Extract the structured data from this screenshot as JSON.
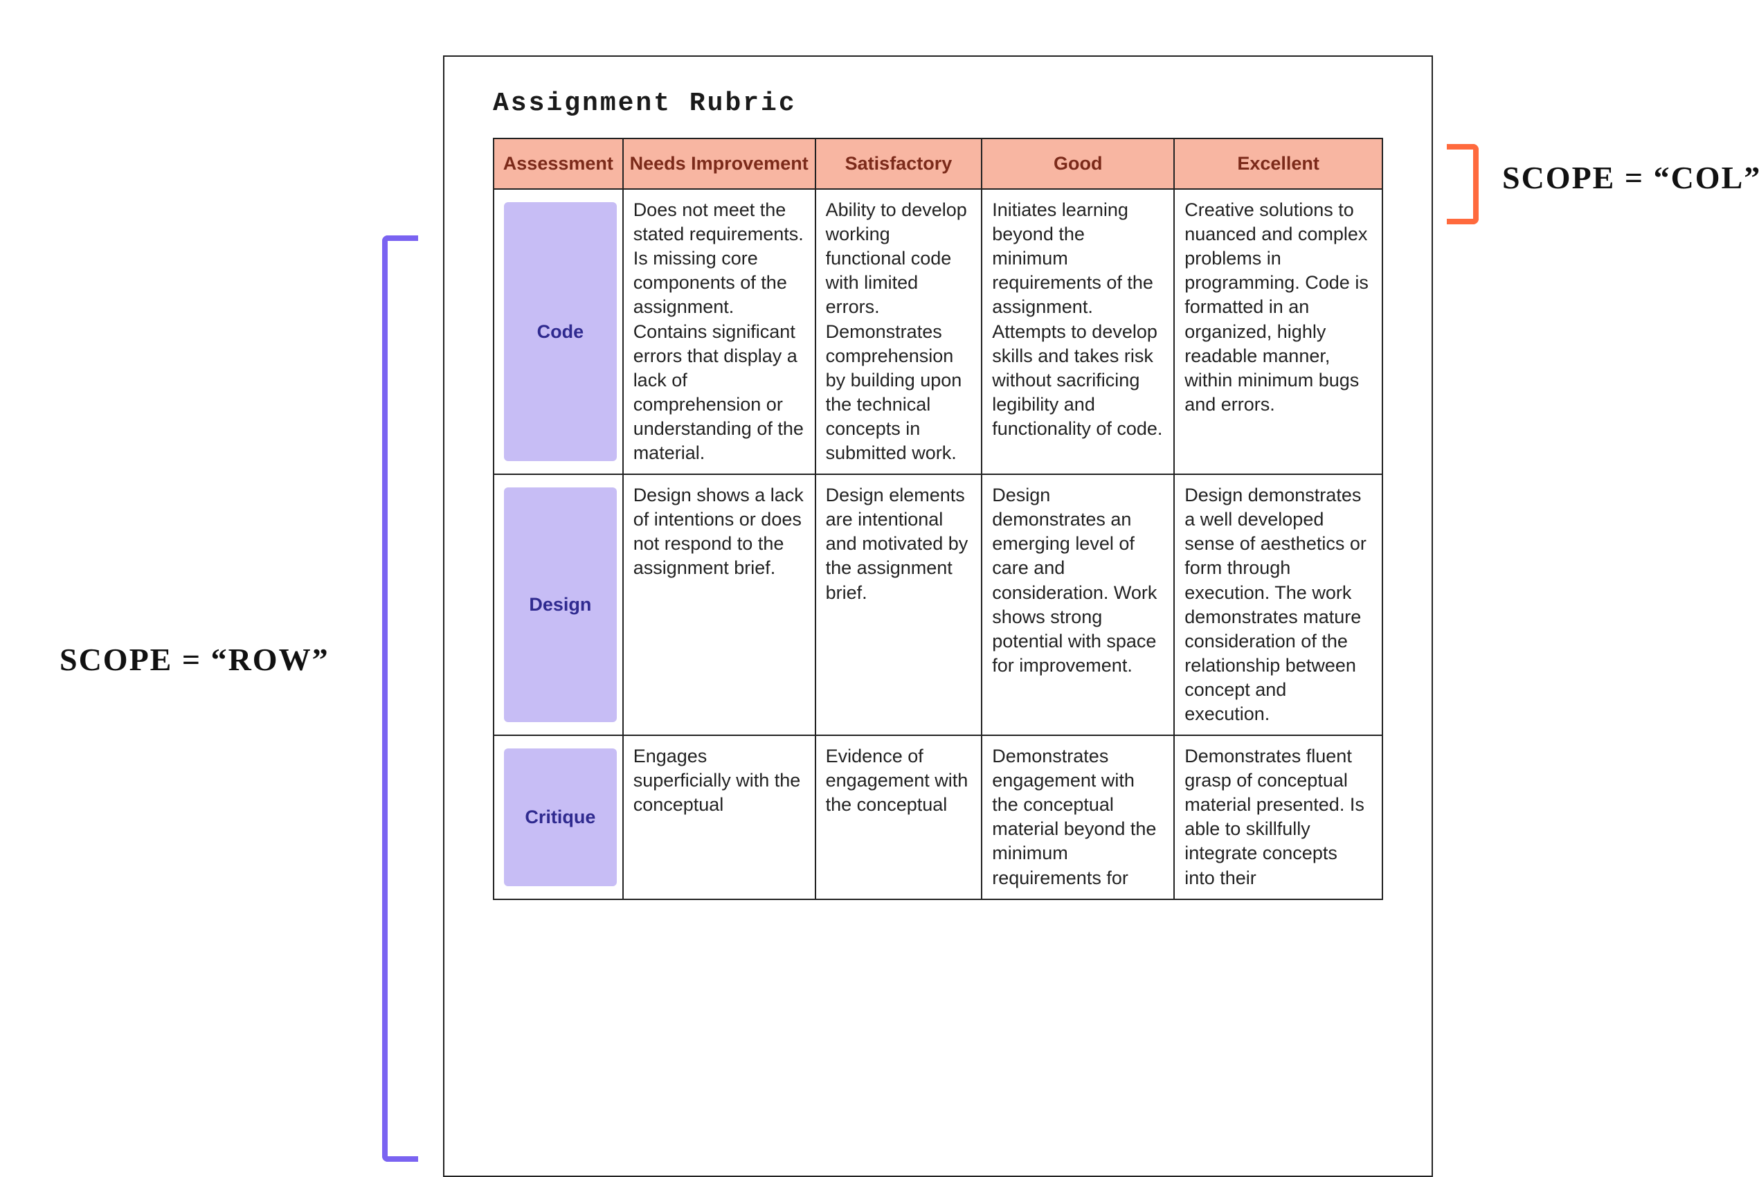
{
  "title": "Assignment Rubric",
  "annotations": {
    "col_label": "SCOPE = “COL”",
    "row_label": "SCOPE = “ROW”"
  },
  "columns": [
    "Assessment",
    "Needs Improvement",
    "Satisfactory",
    "Good",
    "Excellent"
  ],
  "rows": [
    {
      "header": "Code",
      "cells": [
        "Does not meet the stated requirements. Is missing core components of the assignment. Contains significant errors that display a lack of comprehension or understanding of the material.",
        "Ability to develop working functional code with limited errors. Demonstrates comprehension by building upon the technical concepts in submitted work.",
        "Initiates learning beyond the minimum requirements of the assignment. Attempts to develop skills and takes risk without sacrificing legibility and functionality of code.",
        "Creative solutions to nuanced and complex problems in programming. Code is formatted in an organized, highly readable manner, within minimum bugs and errors."
      ]
    },
    {
      "header": "Design",
      "cells": [
        "Design shows a lack of intentions or does not respond to the assignment brief.",
        "Design elements are intentional and motivated by the assignment brief.",
        "Design demonstrates an emerging level of care and consideration. Work shows strong potential with space for improvement.",
        "Design demonstrates a well developed sense of aesthetics or form through execution. The work demonstrates mature consideration of the relationship between concept and execution."
      ]
    },
    {
      "header": "Critique",
      "cells": [
        "Engages superficially with the conceptual",
        "Evidence of engagement with the conceptual",
        "Demonstrates engagement with the conceptual material beyond the minimum requirements for",
        "Demonstrates fluent grasp of conceptual material presented. Is able to skillfully integrate concepts into their"
      ]
    }
  ]
}
